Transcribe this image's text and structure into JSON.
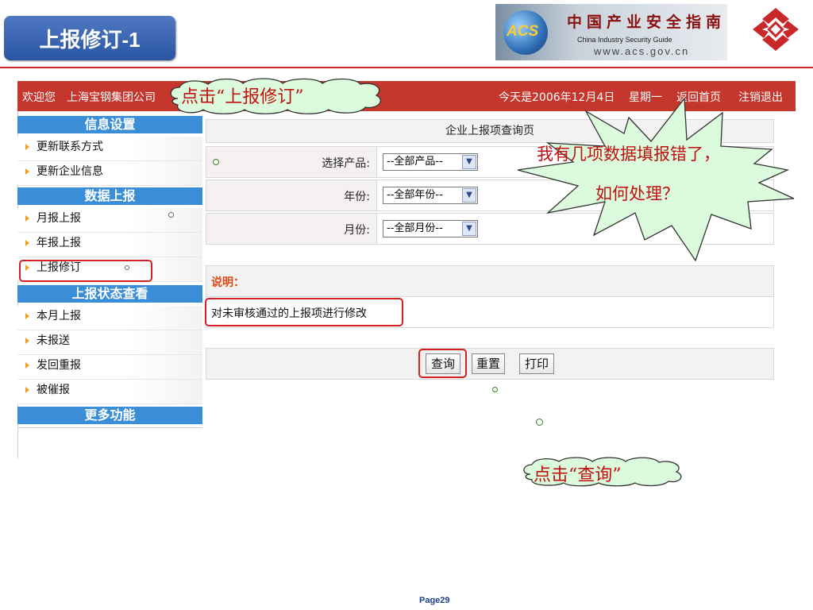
{
  "slide": {
    "title": "上报修订-1",
    "page": "Page29"
  },
  "banner": {
    "globe_text": "ACS",
    "cn_name": "中国产业安全指南",
    "en_name": "China Industry Security Guide",
    "url": "www.acs.gov.cn"
  },
  "topbar": {
    "welcome": "欢迎您",
    "company": "上海宝钢集团公司",
    "date": "今天是2006年12月4日",
    "weekday": "星期一",
    "home": "返回首页",
    "logout": "注销退出"
  },
  "sidebar": {
    "categories": [
      "信息设置",
      "数据上报",
      "上报状态查看",
      "更多功能"
    ],
    "info_items": [
      "更新联系方式",
      "更新企业信息"
    ],
    "report_items": [
      "月报上报",
      "年报上报",
      "上报修订"
    ],
    "status_items": [
      "本月上报",
      "未报送",
      "发回重报",
      "被催报"
    ]
  },
  "main": {
    "page_title": "企业上报项查询页",
    "product_label": "选择产品:",
    "product_value": "--全部产品--",
    "year_label": "年份:",
    "year_value": "--全部年份--",
    "month_label": "月份:",
    "month_value": "--全部月份--",
    "explain_title": "说明：",
    "explain_text": "对未审核通过的上报项进行修改",
    "query_button": "查询",
    "reset_button": "重置",
    "print_button": "打印"
  },
  "callouts": {
    "click_revise": "点击“上报修订”",
    "question_line1": "我有几项数据填报错了，",
    "question_line2": "如何处理？",
    "click_query": "点击“查询”"
  },
  "colors": {
    "topbar": "#c5362c",
    "sidebar_category": "#3a8ed8",
    "highlight": "#d42020",
    "callout_fill": "#dcfadc",
    "callout_text": "#c01010"
  }
}
